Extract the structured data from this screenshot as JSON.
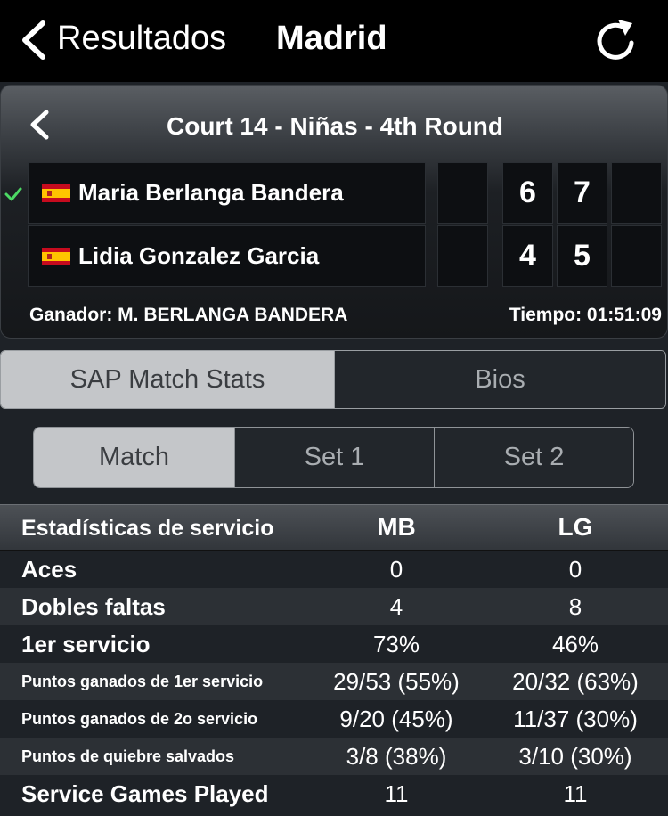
{
  "nav": {
    "back_label": "Resultados",
    "title": "Madrid"
  },
  "match": {
    "title": "Court 14 - Niñas - 4th Round",
    "players": [
      {
        "name": "Maria Berlanga Bandera",
        "flag": "spain-flag",
        "winner": true,
        "sets": [
          "",
          "6",
          "7",
          ""
        ]
      },
      {
        "name": "Lidia Gonzalez Garcia",
        "flag": "spain-flag",
        "winner": false,
        "sets": [
          "",
          "4",
          "5",
          ""
        ]
      }
    ],
    "winner_text": "Ganador: M. BERLANGA BANDERA",
    "time_text": "Tiempo: 01:51:09"
  },
  "tabs": [
    {
      "label": "SAP Match Stats",
      "selected": true
    },
    {
      "label": "Bios",
      "selected": false
    }
  ],
  "subtabs": [
    {
      "label": "Match",
      "selected": true
    },
    {
      "label": "Set 1",
      "selected": false
    },
    {
      "label": "Set 2",
      "selected": false
    }
  ],
  "stats": {
    "header": {
      "label": "Estadísticas de servicio",
      "p1": "MB",
      "p2": "LG"
    },
    "rows": [
      {
        "label": "Aces",
        "p1": "0",
        "p2": "0"
      },
      {
        "label": "Dobles faltas",
        "p1": "4",
        "p2": "8"
      },
      {
        "label": "1er servicio",
        "p1": "73%",
        "p2": "46%"
      },
      {
        "label": "Puntos ganados de 1er servicio",
        "p1": "29/53 (55%)",
        "p2": "20/32 (63%)"
      },
      {
        "label": "Puntos ganados de 2o servicio",
        "p1": "9/20 (45%)",
        "p2": "11/37 (30%)"
      },
      {
        "label": "Puntos de quiebre salvados",
        "p1": "3/8 (38%)",
        "p2": "3/10 (30%)"
      },
      {
        "label": "Service Games Played",
        "p1": "11",
        "p2": "11"
      }
    ]
  },
  "colors": {
    "nav_bg": "#000000",
    "page_bg": "#1e2227",
    "check": "#4cd964",
    "segment_selected": "#c4c6c9"
  }
}
